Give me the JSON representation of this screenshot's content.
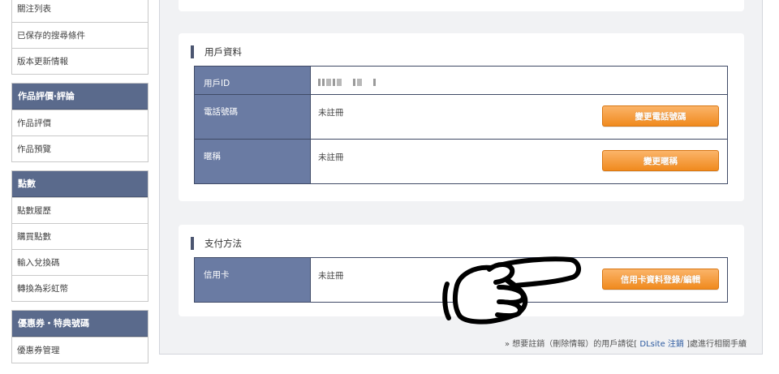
{
  "sidebar": {
    "top_items": [
      "關注列表",
      "已保存的搜尋條件",
      "版本更新情報"
    ],
    "groups": [
      {
        "title": "作品評價‧評論",
        "items": [
          "作品評價",
          "作品預覽"
        ]
      },
      {
        "title": "點數",
        "items": [
          "點數履歷",
          "購買點數",
          "輸入兌換碼",
          "轉換為彩虹幣"
        ]
      },
      {
        "title": "優惠券・特典號碼",
        "items": [
          "優惠券管理"
        ]
      }
    ]
  },
  "user_section": {
    "title": "用戶資料",
    "rows": {
      "user_id_label": "用戶ID",
      "phone_label": "電話號碼",
      "phone_value": "未註冊",
      "phone_button": "變更電話號碼",
      "nickname_label": "暱稱",
      "nickname_value": "未註冊",
      "nickname_button": "變更暱稱"
    }
  },
  "payment_section": {
    "title": "支付方法",
    "card_label": "信用卡",
    "card_value": "未註冊",
    "card_button": "信用卡資料登錄/編輯"
  },
  "footnote": {
    "prefix": "» 想要註銷（刪除情報）的用戶請從[ ",
    "link": "DLsite 注銷",
    "suffix": " ]處進行相關手續"
  },
  "icons": {
    "pointer": "pointing-hand-icon"
  },
  "colors": {
    "sidebar_header": "#5a6a8c",
    "table_label": "#6a7ba3",
    "button_orange": "#f08a1e",
    "panel_bg": "#f1f2f4"
  }
}
